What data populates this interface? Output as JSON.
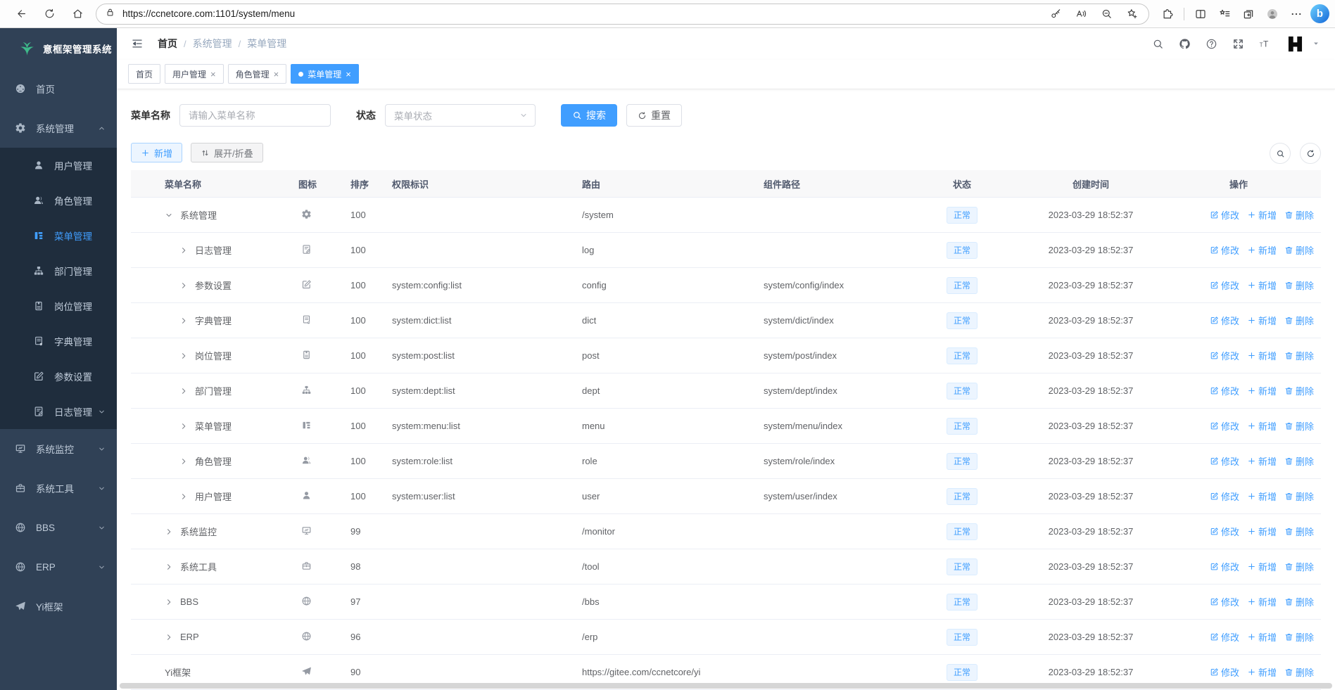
{
  "browser": {
    "url": "https://ccnetcore.com:1101/system/menu",
    "left_icons": [
      "back",
      "refresh",
      "home"
    ],
    "pill_lock_icon": "lock",
    "pill_right_icons": [
      "key",
      "read-aloud",
      "zoom-out",
      "favorite-star"
    ],
    "right_icons": [
      "extensions",
      "split-screen",
      "favorites-bar",
      "collections",
      "profile",
      "more"
    ],
    "bing_label": "b"
  },
  "sidebar": {
    "logo_text": "意框架管理系统",
    "items": [
      {
        "key": "home",
        "label": "首页",
        "icon": "dashboard",
        "level": 0
      },
      {
        "key": "system-mgmt",
        "label": "系统管理",
        "icon": "gear",
        "level": 0,
        "chevron": "up"
      },
      {
        "key": "user-mgmt",
        "label": "用户管理",
        "icon": "user",
        "level": 1
      },
      {
        "key": "role-mgmt",
        "label": "角色管理",
        "icon": "users",
        "level": 1
      },
      {
        "key": "menu-mgmt",
        "label": "菜单管理",
        "icon": "menu-tree",
        "level": 1,
        "active": true
      },
      {
        "key": "dept-mgmt",
        "label": "部门管理",
        "icon": "org-tree",
        "level": 1
      },
      {
        "key": "post-mgmt",
        "label": "岗位管理",
        "icon": "badge",
        "level": 1
      },
      {
        "key": "dict-mgmt",
        "label": "字典管理",
        "icon": "dict",
        "level": 1
      },
      {
        "key": "config-mgmt",
        "label": "参数设置",
        "icon": "edit-square",
        "level": 1
      },
      {
        "key": "log-mgmt",
        "label": "日志管理",
        "icon": "log-doc",
        "level": 1,
        "chevron": "down"
      },
      {
        "key": "monitor",
        "label": "系统监控",
        "icon": "monitor",
        "level": 0,
        "chevron": "down"
      },
      {
        "key": "tool",
        "label": "系统工具",
        "icon": "briefcase",
        "level": 0,
        "chevron": "down"
      },
      {
        "key": "bbs",
        "label": "BBS",
        "icon": "globe",
        "level": 0,
        "chevron": "down"
      },
      {
        "key": "erp",
        "label": "ERP",
        "icon": "globe",
        "level": 0,
        "chevron": "down"
      },
      {
        "key": "yi-framework",
        "label": "Yi框架",
        "icon": "paper-plane",
        "level": 0
      }
    ]
  },
  "header": {
    "breadcrumbs": [
      "首页",
      "系统管理",
      "菜单管理"
    ],
    "right_icons": [
      "search",
      "github",
      "help",
      "fullscreen",
      "font-size"
    ]
  },
  "tabs": [
    {
      "label": "首页",
      "closable": false,
      "active": false
    },
    {
      "label": "用户管理",
      "closable": true,
      "active": false
    },
    {
      "label": "角色管理",
      "closable": true,
      "active": false
    },
    {
      "label": "菜单管理",
      "closable": true,
      "active": true
    }
  ],
  "filters": {
    "name_label": "菜单名称",
    "name_placeholder": "请输入菜单名称",
    "status_label": "状态",
    "status_placeholder": "菜单状态",
    "search_label": "搜索",
    "reset_label": "重置"
  },
  "toolbar": {
    "add_label": "新增",
    "expand_label": "展开/折叠"
  },
  "table": {
    "columns": [
      "菜单名称",
      "图标",
      "排序",
      "权限标识",
      "路由",
      "组件路径",
      "状态",
      "创建时间",
      "操作"
    ],
    "op_labels": {
      "edit": "修改",
      "add": "新增",
      "delete": "删除"
    },
    "rows": [
      {
        "name": "系统管理",
        "icon": "gear",
        "level": 0,
        "expand": "down",
        "order": "100",
        "perm": "",
        "route": "/system",
        "component": "",
        "status": "正常",
        "created": "2023-03-29 18:52:37"
      },
      {
        "name": "日志管理",
        "icon": "log-doc",
        "level": 1,
        "expand": "right",
        "order": "100",
        "perm": "",
        "route": "log",
        "component": "",
        "status": "正常",
        "created": "2023-03-29 18:52:37"
      },
      {
        "name": "参数设置",
        "icon": "edit-square",
        "level": 1,
        "expand": "right",
        "order": "100",
        "perm": "system:config:list",
        "route": "config",
        "component": "system/config/index",
        "status": "正常",
        "created": "2023-03-29 18:52:37"
      },
      {
        "name": "字典管理",
        "icon": "dict",
        "level": 1,
        "expand": "right",
        "order": "100",
        "perm": "system:dict:list",
        "route": "dict",
        "component": "system/dict/index",
        "status": "正常",
        "created": "2023-03-29 18:52:37"
      },
      {
        "name": "岗位管理",
        "icon": "badge",
        "level": 1,
        "expand": "right",
        "order": "100",
        "perm": "system:post:list",
        "route": "post",
        "component": "system/post/index",
        "status": "正常",
        "created": "2023-03-29 18:52:37"
      },
      {
        "name": "部门管理",
        "icon": "org-tree",
        "level": 1,
        "expand": "right",
        "order": "100",
        "perm": "system:dept:list",
        "route": "dept",
        "component": "system/dept/index",
        "status": "正常",
        "created": "2023-03-29 18:52:37"
      },
      {
        "name": "菜单管理",
        "icon": "menu-tree",
        "level": 1,
        "expand": "right",
        "order": "100",
        "perm": "system:menu:list",
        "route": "menu",
        "component": "system/menu/index",
        "status": "正常",
        "created": "2023-03-29 18:52:37"
      },
      {
        "name": "角色管理",
        "icon": "users",
        "level": 1,
        "expand": "right",
        "order": "100",
        "perm": "system:role:list",
        "route": "role",
        "component": "system/role/index",
        "status": "正常",
        "created": "2023-03-29 18:52:37"
      },
      {
        "name": "用户管理",
        "icon": "user",
        "level": 1,
        "expand": "right",
        "order": "100",
        "perm": "system:user:list",
        "route": "user",
        "component": "system/user/index",
        "status": "正常",
        "created": "2023-03-29 18:52:37"
      },
      {
        "name": "系统监控",
        "icon": "monitor",
        "level": 0,
        "expand": "right",
        "order": "99",
        "perm": "",
        "route": "/monitor",
        "component": "",
        "status": "正常",
        "created": "2023-03-29 18:52:37"
      },
      {
        "name": "系统工具",
        "icon": "briefcase",
        "level": 0,
        "expand": "right",
        "order": "98",
        "perm": "",
        "route": "/tool",
        "component": "",
        "status": "正常",
        "created": "2023-03-29 18:52:37"
      },
      {
        "name": "BBS",
        "icon": "globe",
        "level": 0,
        "expand": "right",
        "order": "97",
        "perm": "",
        "route": "/bbs",
        "component": "",
        "status": "正常",
        "created": "2023-03-29 18:52:37"
      },
      {
        "name": "ERP",
        "icon": "globe",
        "level": 0,
        "expand": "right",
        "order": "96",
        "perm": "",
        "route": "/erp",
        "component": "",
        "status": "正常",
        "created": "2023-03-29 18:52:37"
      },
      {
        "name": "Yi框架",
        "icon": "paper-plane",
        "level": 0,
        "expand": "none",
        "order": "90",
        "perm": "",
        "route": "https://gitee.com/ccnetcore/yi",
        "component": "",
        "status": "正常",
        "created": "2023-03-29 18:52:37"
      }
    ]
  },
  "colors": {
    "accent": "#409eff",
    "sidebar_bg": "#304156",
    "submenu_bg": "#1f2d3d",
    "logo_green": "#3eb98a",
    "tag_bg": "#ecf5ff",
    "tag_border": "#d9ecff"
  }
}
